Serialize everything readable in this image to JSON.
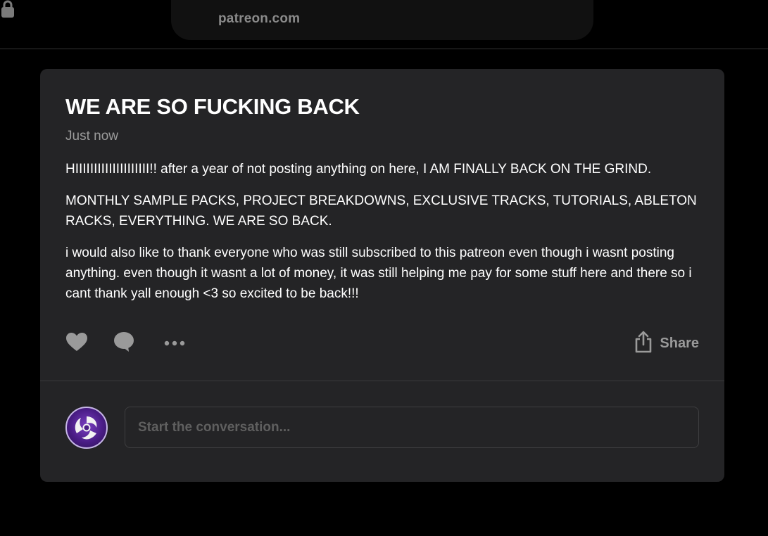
{
  "browser": {
    "url": "patreon.com",
    "lock_icon": "lock-icon"
  },
  "post": {
    "title": "WE ARE SO FUCKING BACK",
    "timestamp": "Just now",
    "paragraphs": [
      "HIIIIIIIIIIIIIIIIIIII!! after a year of not posting anything on here, I AM FINALLY BACK ON THE GRIND.",
      "MONTHLY SAMPLE PACKS, PROJECT BREAKDOWNS, EXCLUSIVE TRACKS, TUTORIALS, ABLETON RACKS, EVERYTHING. WE ARE SO BACK.",
      "i would also like to thank everyone who was still subscribed to this patreon even though i wasnt posting anything. even though it wasnt a lot of money, it was still helping me pay for some stuff here and there so i cant thank yall enough <3 so excited to be back!!!"
    ]
  },
  "actions": {
    "like_icon": "heart-icon",
    "comment_icon": "comment-bubble-icon",
    "more_icon": "more-horizontal-icon",
    "share_icon": "share-upload-icon",
    "share_label": "Share"
  },
  "comments": {
    "placeholder": "Start the conversation...",
    "avatar_icon": "user-avatar"
  },
  "colors": {
    "background": "#000000",
    "card": "#242426",
    "icon": "#9a9a9a",
    "text": "#ffffff"
  }
}
